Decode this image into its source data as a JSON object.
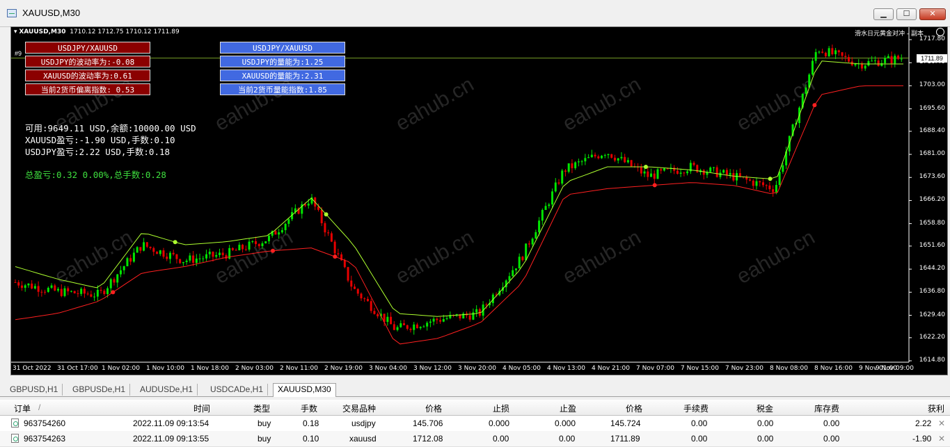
{
  "window": {
    "title": "XAUUSD,M30",
    "buttons": {
      "minimize": "▁",
      "maximize": "☐",
      "close": "✕"
    }
  },
  "chart": {
    "info": {
      "symbol": "XAUUSD,M30",
      "ohlc": "1710.12 1712.75 1710.12 1711.89"
    },
    "ea_name": "滑水日元黄金对冲 - 副本",
    "corner_label": "#9",
    "current_price": "1711.89",
    "y_labels": [
      "1717.80",
      "1710.40",
      "1703.00",
      "1695.60",
      "1688.40",
      "1681.00",
      "1673.60",
      "1666.20",
      "1658.80",
      "1651.60",
      "1644.20",
      "1636.80",
      "1629.40",
      "1622.20",
      "1614.80"
    ],
    "x_labels": [
      "31 Oct 2022",
      "31 Oct 17:00",
      "1 Nov 02:00",
      "1 Nov 10:00",
      "1 Nov 18:00",
      "2 Nov 03:00",
      "2 Nov 11:00",
      "2 Nov 19:00",
      "3 Nov 04:00",
      "3 Nov 12:00",
      "3 Nov 20:00",
      "4 Nov 05:00",
      "4 Nov 13:00",
      "4 Nov 21:00",
      "7 Nov 07:00",
      "7 Nov 15:00",
      "7 Nov 23:00",
      "8 Nov 08:00",
      "8 Nov 16:00",
      "9 Nov 01:00",
      "9 Nov 09:00"
    ],
    "watermark": "eahub.cn",
    "panel_left": [
      "USDJPY/XAUUSD",
      "USDJPY的波动率为:-0.08",
      "XAUUSD的波动率为:0.61",
      "当前2货币偏离指数: 0.53"
    ],
    "panel_right": [
      "USDJPY/XAUUSD",
      "USDJPY的量能为:1.25",
      "XAUUSD的量能为:2.31",
      "当前2货币量能指数:1.85"
    ],
    "account": {
      "available": "可用:9649.11 USD,余额:10000.00 USD",
      "xauusd_pl": "XAUUSD盈亏:-1.90 USD,手数:0.10",
      "usdjpy_pl": "USDJPY盈亏:2.22 USD,手数:0.18",
      "total": "总盈亏:0.32 0.00%,总手数:0.28"
    },
    "colors": {
      "bull": "#00e600",
      "bear": "#e60000",
      "stop_up": "#adff2f",
      "stop_down": "#ff2020"
    },
    "chart_data": {
      "type": "candlestick",
      "symbol": "XAUUSD",
      "timeframe": "M30",
      "ylim": [
        1614.8,
        1717.8
      ],
      "x": [
        "31 Oct 2022",
        "31 Oct 17:00",
        "1 Nov 02:00",
        "1 Nov 10:00",
        "1 Nov 18:00",
        "2 Nov 03:00",
        "2 Nov 11:00",
        "2 Nov 19:00",
        "3 Nov 04:00",
        "3 Nov 12:00",
        "3 Nov 20:00",
        "4 Nov 05:00",
        "4 Nov 13:00",
        "4 Nov 21:00",
        "7 Nov 07:00",
        "7 Nov 15:00",
        "7 Nov 23:00",
        "8 Nov 08:00",
        "8 Nov 16:00",
        "9 Nov 01:00",
        "9 Nov 09:00"
      ],
      "series": [
        {
          "values": [
            1640,
            1637,
            1636,
            1652,
            1647,
            1649,
            1654,
            1667,
            1638,
            1625,
            1628,
            1630,
            1648,
            1676,
            1682,
            1674,
            1677,
            1674,
            1670,
            1715,
            1710,
            1711.89
          ]
        }
      ],
      "stop_up_line": [
        1645,
        1641,
        1638,
        1656,
        1652,
        1653,
        1655,
        1667,
        1652,
        1630,
        1629,
        1630,
        1645,
        1672,
        1677,
        1677,
        1676,
        1674,
        1673,
        1711,
        1710,
        1710
      ],
      "stop_down_line": [
        1628,
        1630,
        1634,
        1643,
        1645,
        1648,
        1650,
        1651,
        1646,
        1620,
        1622,
        1627,
        1640,
        1668,
        1670,
        1671,
        1672,
        1671,
        1668,
        1700,
        1703,
        1703
      ]
    }
  },
  "tabs": [
    "GBPUSD,H1",
    "GBPUSDe,H1",
    "AUDUSDe,H1",
    "USDCADe,H1",
    "XAUUSD,M30"
  ],
  "table": {
    "headers": [
      "订单",
      "/",
      "时间",
      "类型",
      "手数",
      "交易品种",
      "价格",
      "止损",
      "止盈",
      "价格",
      "手续费",
      "税金",
      "库存费",
      "获利"
    ],
    "rows": [
      [
        "963754260",
        "2022.11.09 09:13:54",
        "buy",
        "0.18",
        "usdjpy",
        "145.706",
        "0.000",
        "0.000",
        "145.724",
        "0.00",
        "0.00",
        "0.00",
        "2.22"
      ],
      [
        "963754263",
        "2022.11.09 09:13:55",
        "buy",
        "0.10",
        "xauusd",
        "1712.08",
        "0.00",
        "0.00",
        "1711.89",
        "0.00",
        "0.00",
        "0.00",
        "-1.90"
      ]
    ]
  }
}
